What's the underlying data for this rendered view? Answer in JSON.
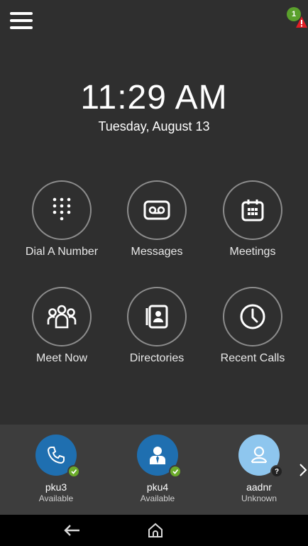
{
  "header": {
    "menu_icon": "hamburger-menu-icon",
    "status_count": "1",
    "status_color": "#5aa02c",
    "alert_color": "#e01e24"
  },
  "clock": {
    "time": "11:29 AM",
    "date": "Tuesday, August 13"
  },
  "apps": [
    {
      "label": "Dial A Number",
      "icon": "dialpad-icon"
    },
    {
      "label": "Messages",
      "icon": "voicemail-icon"
    },
    {
      "label": "Meetings",
      "icon": "calendar-icon"
    },
    {
      "label": "Meet Now",
      "icon": "group-icon"
    },
    {
      "label": "Directories",
      "icon": "contacts-book-icon"
    },
    {
      "label": "Recent Calls",
      "icon": "clock-icon"
    }
  ],
  "favorites": [
    {
      "name": "pku3",
      "presence": "Available",
      "icon": "phone-icon",
      "avatar_color": "#1f6fb0",
      "badge_color": "#6bab2a"
    },
    {
      "name": "pku4",
      "presence": "Available",
      "icon": "person-icon",
      "avatar_color": "#1f6fb0",
      "badge_color": "#6bab2a"
    },
    {
      "name": "aadnr",
      "presence": "Unknown",
      "icon": "person-outline-icon",
      "avatar_color": "#8ec6ee",
      "badge_symbol": "?",
      "badge_color": "#222222"
    }
  ],
  "colors": {
    "background": "#2f2f2f",
    "favorites_bar": "#3d3d3d",
    "nav_bar": "#000000",
    "circle_border": "#8c8c8c"
  }
}
